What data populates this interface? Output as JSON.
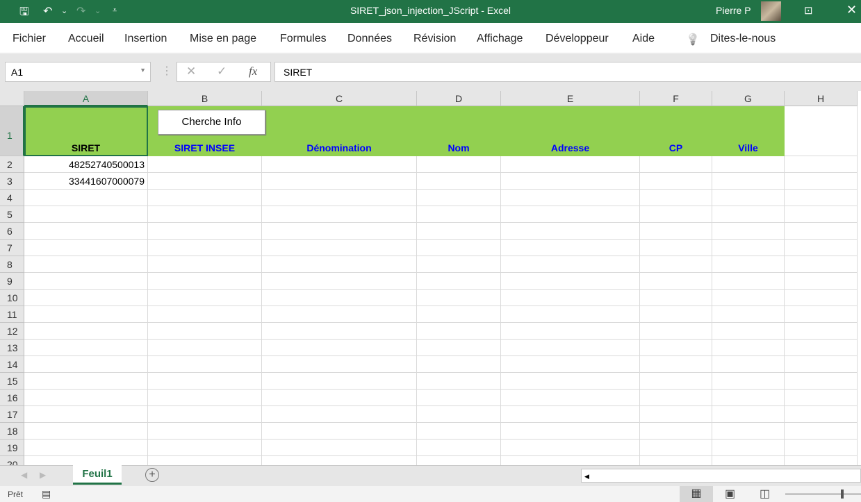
{
  "window": {
    "title": "SIRET_json_injection_JScript  -  Excel",
    "user": "Pierre P",
    "qat": {
      "save": "🖫",
      "undo": "↶",
      "undo_dd": "⌄",
      "redo": "↷",
      "redo_dd": "⌄",
      "customize": "⩡"
    },
    "ribbon_display": "⊡",
    "close": "✕"
  },
  "menu": [
    {
      "label": "Fichier"
    },
    {
      "label": "Accueil"
    },
    {
      "label": "Insertion"
    },
    {
      "label": "Mise en page"
    },
    {
      "label": "Formules"
    },
    {
      "label": "Données"
    },
    {
      "label": "Révision"
    },
    {
      "label": "Affichage"
    },
    {
      "label": "Développeur"
    },
    {
      "label": "Aide"
    },
    {
      "label": "Dites-le-nous"
    }
  ],
  "formula_bar": {
    "name_box": "A1",
    "cancel": "✕",
    "enter": "✓",
    "fx": "fx",
    "value": "SIRET"
  },
  "columns": [
    "A",
    "B",
    "C",
    "D",
    "E",
    "F",
    "G",
    "H"
  ],
  "rows": [
    "1",
    "2",
    "3",
    "4",
    "5",
    "6",
    "7",
    "8",
    "9",
    "10",
    "11",
    "12",
    "13",
    "14",
    "15",
    "16",
    "17",
    "18",
    "19",
    "20"
  ],
  "headers": [
    "SIRET",
    "SIRET INSEE",
    "Dénomination",
    "Nom",
    "Adresse",
    "CP",
    "Ville"
  ],
  "data": [
    [
      "48252740500013"
    ],
    [
      "33441607000079"
    ]
  ],
  "button": {
    "label": "Cherche Info"
  },
  "sheets": {
    "active": "Feuil1",
    "add": "+"
  },
  "status": {
    "text": "Prêt"
  },
  "colors": {
    "header_fill": "#92d050",
    "header_text": "#0000ff",
    "excel_green": "#217346"
  }
}
